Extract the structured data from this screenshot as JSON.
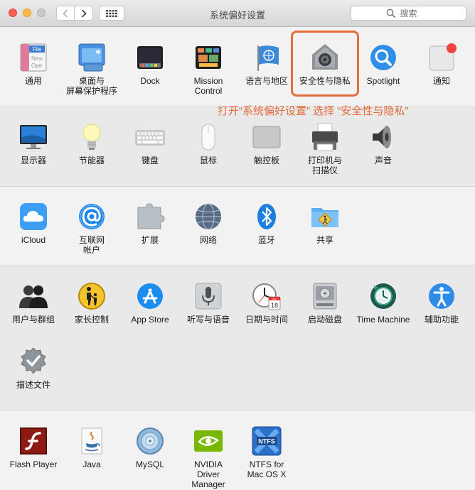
{
  "window": {
    "title": "系统偏好设置"
  },
  "search": {
    "placeholder": "搜索"
  },
  "annotation": "打开“系统偏好设置” 选择 “安全性与隐私”",
  "rows": [
    [
      {
        "id": "general",
        "label": "通用",
        "icon": "general-icon"
      },
      {
        "id": "desktop",
        "label": "桌面与\n屏幕保护程序",
        "icon": "desktop-screensaver-icon"
      },
      {
        "id": "dock",
        "label": "Dock",
        "icon": "dock-icon"
      },
      {
        "id": "mission",
        "label": "Mission\nControl",
        "icon": "mission-control-icon"
      },
      {
        "id": "language",
        "label": "语言与地区",
        "icon": "language-region-icon"
      },
      {
        "id": "security",
        "label": "安全性与隐私",
        "icon": "security-privacy-icon"
      },
      {
        "id": "spotlight",
        "label": "Spotlight",
        "icon": "spotlight-icon"
      },
      {
        "id": "notifications",
        "label": "通知",
        "icon": "notifications-icon"
      }
    ],
    [
      {
        "id": "displays",
        "label": "显示器",
        "icon": "displays-icon"
      },
      {
        "id": "energy",
        "label": "节能器",
        "icon": "energy-saver-icon"
      },
      {
        "id": "keyboard",
        "label": "键盘",
        "icon": "keyboard-icon"
      },
      {
        "id": "mouse",
        "label": "鼠标",
        "icon": "mouse-icon"
      },
      {
        "id": "trackpad",
        "label": "触控板",
        "icon": "trackpad-icon"
      },
      {
        "id": "printers",
        "label": "打印机与\n扫描仪",
        "icon": "printer-icon"
      },
      {
        "id": "sound",
        "label": "声音",
        "icon": "sound-icon"
      }
    ],
    [
      {
        "id": "icloud",
        "label": "iCloud",
        "icon": "icloud-icon"
      },
      {
        "id": "internet",
        "label": "互联网\n帐户",
        "icon": "internet-accounts-icon"
      },
      {
        "id": "extensions",
        "label": "扩展",
        "icon": "extensions-icon"
      },
      {
        "id": "network",
        "label": "网络",
        "icon": "network-icon"
      },
      {
        "id": "bluetooth",
        "label": "蓝牙",
        "icon": "bluetooth-icon"
      },
      {
        "id": "sharing",
        "label": "共享",
        "icon": "sharing-icon"
      }
    ],
    [
      {
        "id": "users",
        "label": "用户与群组",
        "icon": "users-groups-icon"
      },
      {
        "id": "parental",
        "label": "家长控制",
        "icon": "parental-controls-icon"
      },
      {
        "id": "appstore",
        "label": "App Store",
        "icon": "app-store-icon"
      },
      {
        "id": "dictation",
        "label": "听写与语音",
        "icon": "dictation-icon"
      },
      {
        "id": "datetime",
        "label": "日期与时间",
        "icon": "date-time-icon"
      },
      {
        "id": "startup",
        "label": "启动磁盘",
        "icon": "startup-disk-icon"
      },
      {
        "id": "timemachine",
        "label": "Time Machine",
        "icon": "time-machine-icon"
      },
      {
        "id": "accessibility",
        "label": "辅助功能",
        "icon": "accessibility-icon"
      }
    ],
    [
      {
        "id": "profiles",
        "label": "描述文件",
        "icon": "profiles-icon"
      }
    ],
    [
      {
        "id": "flash",
        "label": "Flash Player",
        "icon": "flash-player-icon"
      },
      {
        "id": "java",
        "label": "Java",
        "icon": "java-icon"
      },
      {
        "id": "mysql",
        "label": "MySQL",
        "icon": "mysql-icon"
      },
      {
        "id": "nvidia",
        "label": "NVIDIA\nDriver Manager",
        "icon": "nvidia-icon"
      },
      {
        "id": "ntfs",
        "label": "NTFS for\nMac OS X",
        "icon": "ntfs-icon"
      }
    ]
  ],
  "icon_text": {
    "general": [
      "File",
      "New",
      "Ope"
    ],
    "ntfs": "NTFS",
    "calendar_day": "18",
    "calendar_month": "JUL"
  },
  "colors": {
    "highlight": "#e36b3c",
    "accent": "#1d8cf2"
  }
}
